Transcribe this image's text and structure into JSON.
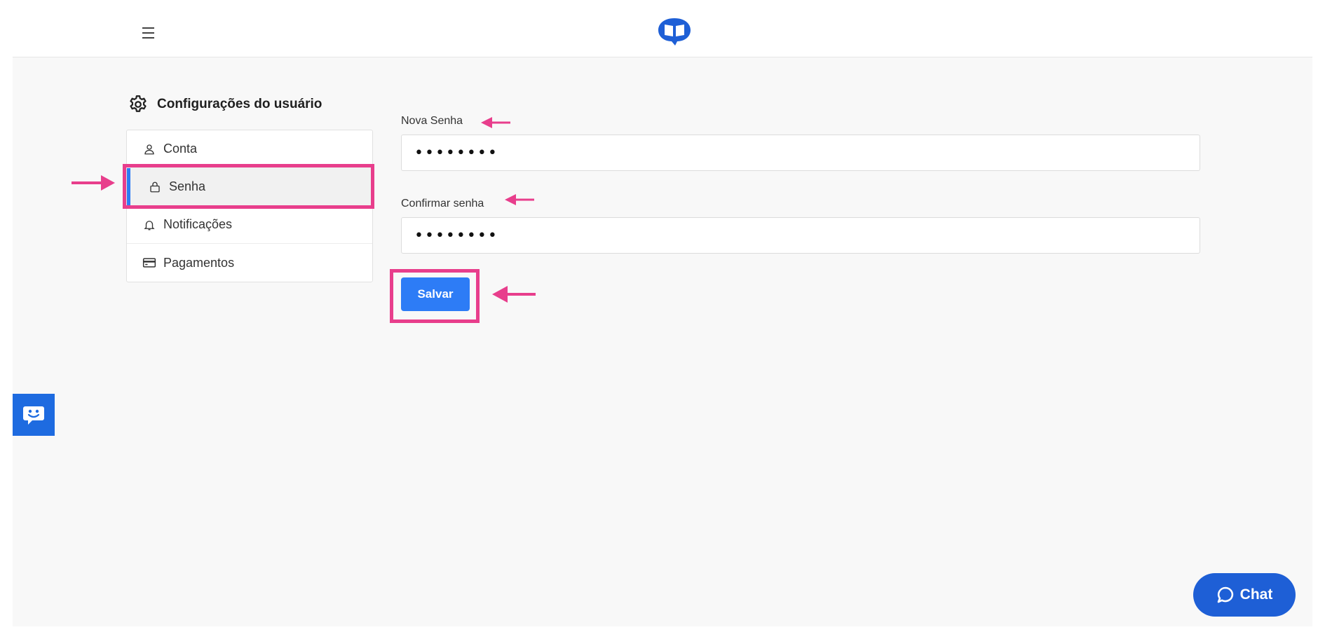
{
  "header": {
    "menu_icon": "hamburger-icon",
    "logo_icon": "book-chat-logo"
  },
  "settings": {
    "title": "Configurações do usuário",
    "title_icon": "gear-icon",
    "menu": [
      {
        "label": "Conta",
        "icon": "user-icon",
        "active": false
      },
      {
        "label": "Senha",
        "icon": "lock-icon",
        "active": true
      },
      {
        "label": "Notificações",
        "icon": "bell-icon",
        "active": false
      },
      {
        "label": "Pagamentos",
        "icon": "credit-card-icon",
        "active": false
      }
    ]
  },
  "form": {
    "new_password": {
      "label": "Nova Senha",
      "value": "••••••••"
    },
    "confirm_password": {
      "label": "Confirmar senha",
      "value": "••••••••"
    },
    "save_label": "Salvar"
  },
  "widgets": {
    "feedback_icon": "smile-chat-icon",
    "chat_label": "Chat",
    "chat_icon": "chat-bubble-icon"
  },
  "colors": {
    "accent": "#2d7cf6",
    "annotation": "#e83e8c",
    "chat": "#1e5fd6",
    "background": "#f8f8f8"
  }
}
